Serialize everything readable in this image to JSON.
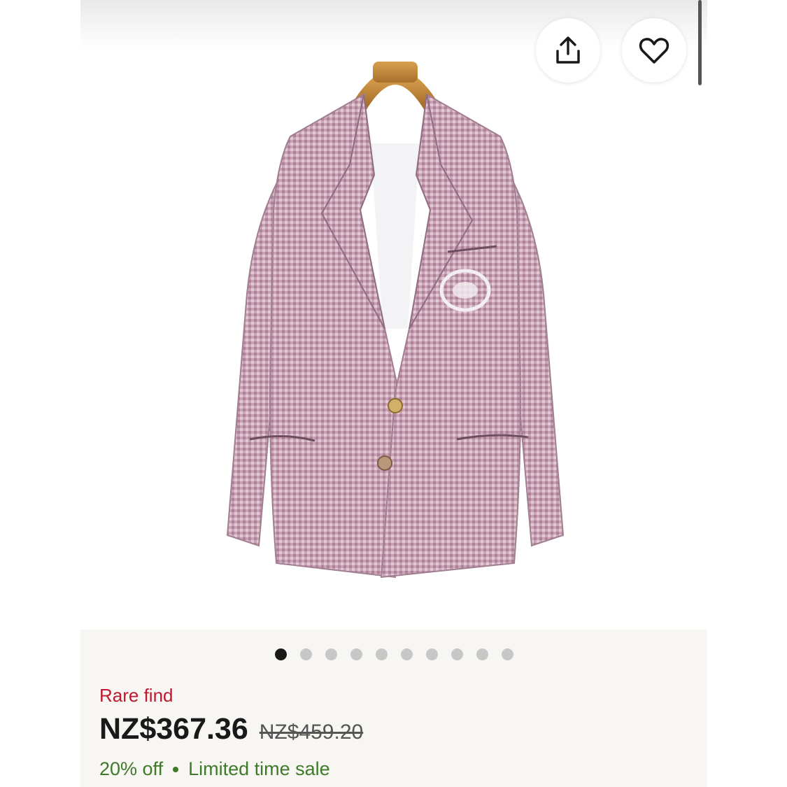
{
  "actions": {
    "share_icon": "share-icon",
    "favorite_icon": "heart-icon"
  },
  "gallery": {
    "image_count": 10,
    "active_index": 0
  },
  "listing": {
    "badge": "Rare find",
    "price": "NZ$367.36",
    "original_price": "NZ$459.20",
    "discount": "20% off",
    "sale_label": "Limited time sale"
  },
  "colors": {
    "badge": "#c0182f",
    "discount": "#3f7a2a",
    "panel_background": "#f7f6f3",
    "dot_active": "#191919",
    "dot_inactive": "#c7c7c7"
  }
}
